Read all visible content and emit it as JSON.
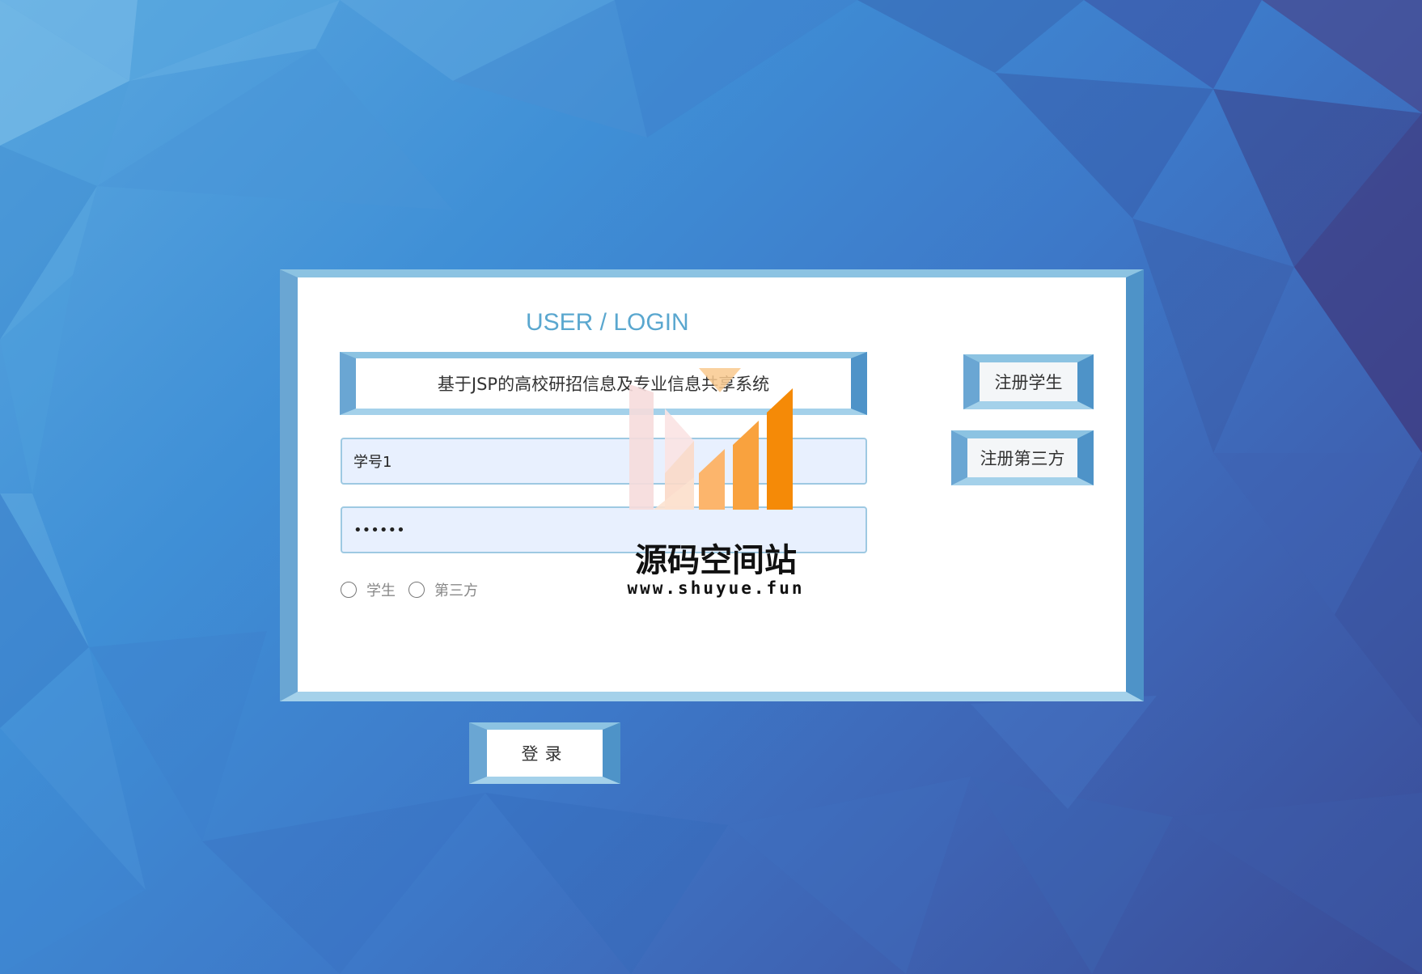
{
  "login": {
    "heading": "USER / LOGIN",
    "system_name": "基于JSP的高校研招信息及专业信息共享系统",
    "username_value": "学号1",
    "password_value": "••••••",
    "roles": [
      {
        "label": "学生",
        "selected": false
      },
      {
        "label": "第三方",
        "selected": false
      }
    ],
    "login_label": "登录"
  },
  "actions": {
    "register_student": "注册学生",
    "register_third_party": "注册第三方"
  },
  "watermark": {
    "name": "源码空间站",
    "url": "www.shuyue.fun"
  },
  "colors": {
    "accent": "#5aa7cf",
    "frame": "#6aa6d3",
    "field_bg": "#e8f0fe",
    "watermark_orange": "#f58a07"
  }
}
